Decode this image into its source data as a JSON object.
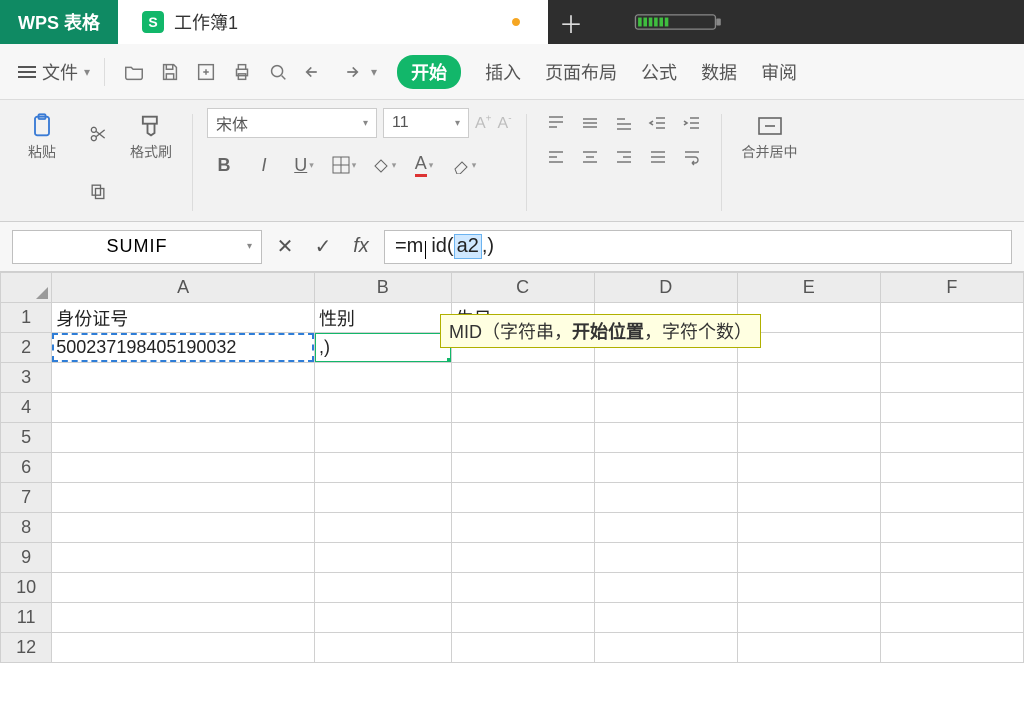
{
  "titlebar": {
    "app_name": "WPS 表格",
    "doc_name": "工作簿1"
  },
  "menubar": {
    "file_label": "文件",
    "tabs": [
      "开始",
      "插入",
      "页面布局",
      "公式",
      "数据",
      "审阅"
    ]
  },
  "ribbon": {
    "paste_label": "粘贴",
    "format_painter_label": "格式刷",
    "font_name": "宋体",
    "font_size": "11",
    "merge_label": "合并居中"
  },
  "formulabar": {
    "namebox": "SUMIF",
    "formula_prefix": "=m",
    "formula_mid": "id(",
    "formula_ref": "a2",
    "formula_suffix": ",)"
  },
  "tooltip": {
    "fn": "MID",
    "args_pre": "（字符串，",
    "args_bold": "开始位置",
    "args_post": "，字符个数）"
  },
  "grid": {
    "columns": [
      "A",
      "B",
      "C",
      "D",
      "E",
      "F"
    ],
    "row_headers": [
      "1",
      "2",
      "3",
      "4",
      "5",
      "6",
      "7",
      "8",
      "9",
      "10",
      "11",
      "12"
    ],
    "cells": {
      "A1": "身份证号",
      "B1": "性别",
      "C1": "生日",
      "A2": "500237198405190032",
      "B2": ",)"
    }
  }
}
